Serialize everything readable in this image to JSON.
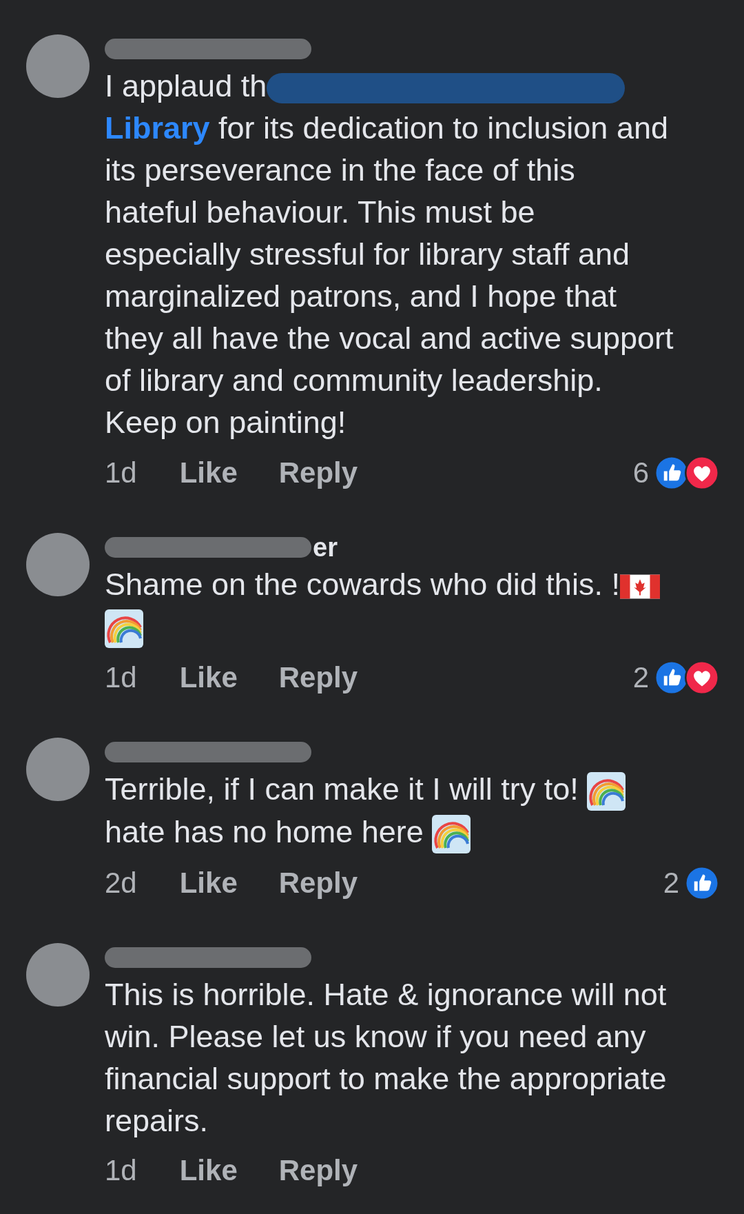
{
  "comments": [
    {
      "segments": [
        {
          "kind": "text",
          "text": "I applaud th"
        },
        {
          "kind": "redaction"
        },
        {
          "kind": "link",
          "text": "Library"
        },
        {
          "kind": "text",
          "text": " for its dedication to inclusion and its perseverance in the face of this hateful behaviour. This must be especially stressful for library staff and marginalized patrons, and I hope that they all have the vocal and active support of library and community leadership. Keep on painting!"
        }
      ],
      "time": "1d",
      "like": "Like",
      "reply": "Reply",
      "reaction_count": "6",
      "like_reaction": true,
      "love_reaction": true
    },
    {
      "name_fragment": "er",
      "segments": [
        {
          "kind": "text",
          "text": "Shame on the cowards who did this. !"
        },
        {
          "kind": "flag"
        },
        {
          "kind": "break"
        },
        {
          "kind": "rainbow"
        }
      ],
      "time": "1d",
      "like": "Like",
      "reply": "Reply",
      "reaction_count": "2",
      "like_reaction": true,
      "love_reaction": true
    },
    {
      "segments": [
        {
          "kind": "text",
          "text": "Terrible, if I can make it I will try to! "
        },
        {
          "kind": "rainbow"
        },
        {
          "kind": "break"
        },
        {
          "kind": "text",
          "text": "hate has no home here "
        },
        {
          "kind": "rainbow"
        }
      ],
      "time": "2d",
      "like": "Like",
      "reply": "Reply",
      "reaction_count": "2",
      "like_reaction": true,
      "love_reaction": false
    },
    {
      "segments": [
        {
          "kind": "text",
          "text": "This is horrible. Hate & ignorance will not win. Please let us know if you need any financial support to make the appropriate repairs."
        }
      ],
      "time": "1d",
      "like": "Like",
      "reply": "Reply",
      "like_reaction": false,
      "love_reaction": false
    }
  ]
}
